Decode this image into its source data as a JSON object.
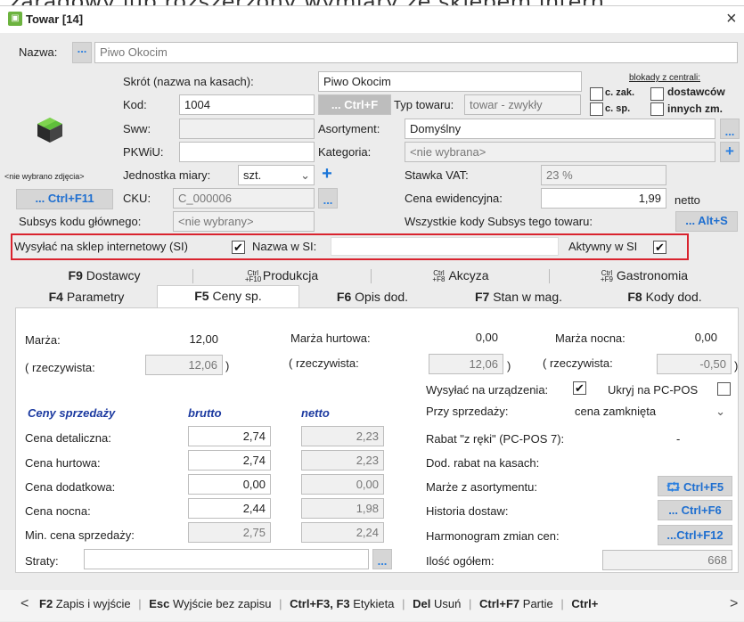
{
  "page_top_text": "zaradowy lub rozszerzony wymiary ze sklepem intern",
  "window": {
    "title": "Towar [14]",
    "close": "×"
  },
  "name_row": {
    "label": "Nazwa:",
    "dots": "...",
    "value": "Piwo Okocim"
  },
  "fields": {
    "skrot_label": "Skrót (nazwa na kasach):",
    "skrot_value": "Piwo Okocim",
    "kod_label": "Kod:",
    "kod_value": "1004",
    "ctrlf_btn": "... Ctrl+F",
    "typ_label": "Typ towaru:",
    "typ_value": "towar - zwykły",
    "blokady_title": "blokady z centrali:",
    "blk_czak": "c. zak.",
    "blk_dostawcow": "dostawców",
    "blk_csp": "c. sp.",
    "blk_innych": "innych zm.",
    "sww_label": "Sww:",
    "sww_value": "",
    "asort_label": "Asortyment:",
    "asort_value": "Domyślny",
    "pkwiu_label": "PKWiU:",
    "pkwiu_value": "",
    "kat_label": "Kategoria:",
    "kat_value": "<nie wybrana>",
    "no_image": "<nie wybrano zdjęcia>",
    "jm_label": "Jednostka miary:",
    "jm_value": "szt.",
    "vat_label": "Stawka VAT:",
    "vat_value": "23 %",
    "ctrlf11": "... Ctrl+F11",
    "cku_label": "CKU:",
    "cku_value": "C_000006",
    "cena_ew_label": "Cena ewidencyjna:",
    "cena_ew_value": "1,99",
    "netto": "netto",
    "subsys_label": "Subsys kodu głównego:",
    "subsys_value": "<nie wybrany>",
    "all_codes_label": "Wszystkie kody Subsys tego towaru:",
    "altS": "... Alt+S",
    "si_label": "Wysyłać na sklep internetowy (SI)",
    "si_name_label": "Nazwa w SI:",
    "si_name_value": "",
    "si_active": "Aktywny w SI"
  },
  "tabs_row1": [
    {
      "key": "F9",
      "label": "Dostawcy"
    },
    {
      "key": "Ctrl +F10",
      "label": "Produkcja"
    },
    {
      "key": "Ctrl +F8",
      "label": "Akcyza"
    },
    {
      "key": "Ctrl +F9",
      "label": "Gastronomia"
    }
  ],
  "tabs_row2": [
    {
      "key": "F4",
      "label": "Parametry"
    },
    {
      "key": "F5",
      "label": "Ceny sp."
    },
    {
      "key": "F6",
      "label": "Opis dod."
    },
    {
      "key": "F7",
      "label": "Stan w mag."
    },
    {
      "key": "F8",
      "label": "Kody dod."
    }
  ],
  "prices": {
    "marza_label": "Marża:",
    "marza_value": "12,00",
    "rzecz_label": "( rzeczywista:",
    "rzecz_value": "12,06",
    "close_paren": ")",
    "marza_hurt_label": "Marża hurtowa:",
    "marza_hurt_value": "0,00",
    "rzecz2_value": "12,06",
    "marza_noc_label": "Marża nocna:",
    "marza_noc_value": "0,00",
    "rzecz3_value": "-0,50",
    "send_label": "Wysyłać na urządzenia:",
    "hide_label": "Ukryj na PC-POS",
    "ceny_header": "Ceny sprzedaży",
    "brutto_header": "brutto",
    "netto_header": "netto",
    "przy_label": "Przy sprzedaży:",
    "przy_value": "cena zamknięta",
    "rows": [
      {
        "label": "Cena detaliczna:",
        "brutto": "2,74",
        "netto": "2,23"
      },
      {
        "label": "Cena hurtowa:",
        "brutto": "2,74",
        "netto": "2,23"
      },
      {
        "label": "Cena dodatkowa:",
        "brutto": "0,00",
        "netto": "0,00"
      },
      {
        "label": "Cena nocna:",
        "brutto": "2,44",
        "netto": "1,98"
      },
      {
        "label": "Min. cena sprzedaży:",
        "brutto": "2,75",
        "netto": "2,24"
      }
    ],
    "straty_label": "Straty:",
    "rabat_label": "Rabat \"z ręki\" (PC-POS 7):",
    "rabat_dash": "-",
    "dod_rabat_label": "Dod. rabat na kasach:",
    "marze_asort_label": "Marże z asortymentu:",
    "ctrlf5": "Ctrl+F5",
    "historia_label": "Historia dostaw:",
    "ctrlf6": "... Ctrl+F6",
    "harmonogram_label": "Harmonogram zmian cen:",
    "ctrlf12": "...Ctrl+F12",
    "ilosc_label": "Ilość ogółem:",
    "ilosc_value": "668"
  },
  "footer": [
    {
      "key": "F2",
      "label": "Zapis i wyjście"
    },
    {
      "key": "Esc",
      "label": "Wyjście bez zapisu"
    },
    {
      "key": "Ctrl+F3, F3",
      "label": "Etykieta"
    },
    {
      "key": "Del",
      "label": "Usuń"
    },
    {
      "key": "Ctrl+F7",
      "label": "Partie"
    },
    {
      "key": "Ctrl+",
      "label": ""
    }
  ],
  "colors": {
    "accent": "#1f6fd0",
    "highlight_border": "#d9232e",
    "ceny_header": "#1c3aa0"
  }
}
